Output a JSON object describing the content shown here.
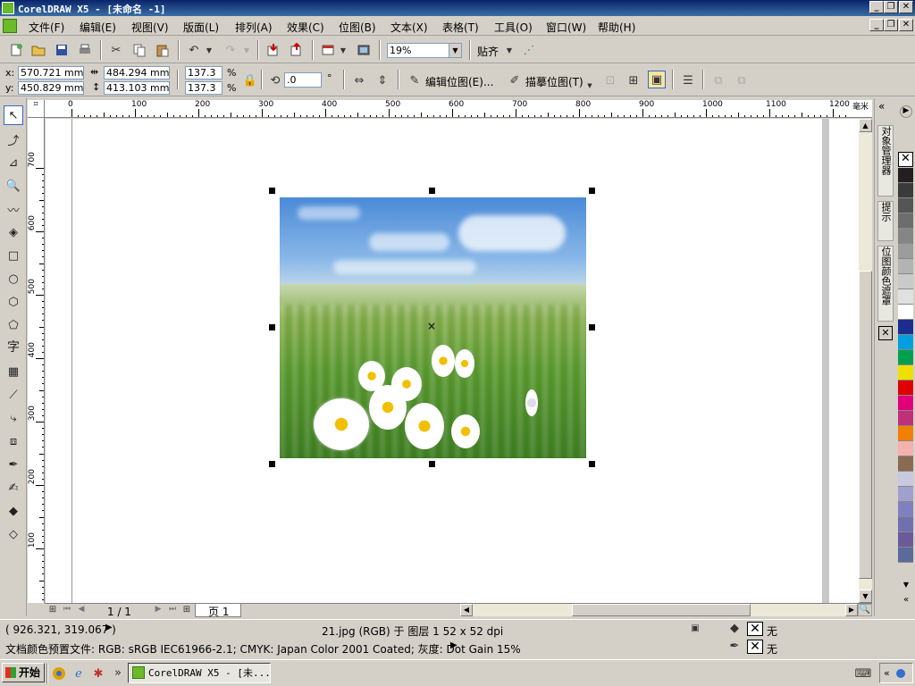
{
  "window": {
    "title": "CorelDRAW X5 - [未命名 -1]",
    "controls": {
      "minimize": "_",
      "restore": "❐",
      "close": "✕"
    }
  },
  "menu": {
    "items": [
      {
        "label": "文件(F)"
      },
      {
        "label": "编辑(E)"
      },
      {
        "label": "视图(V)"
      },
      {
        "label": "版面(L)"
      },
      {
        "label": "排列(A)"
      },
      {
        "label": "效果(C)"
      },
      {
        "label": "位图(B)"
      },
      {
        "label": "文本(X)"
      },
      {
        "label": "表格(T)"
      },
      {
        "label": "工具(O)"
      },
      {
        "label": "窗口(W)"
      },
      {
        "label": "帮助(H)"
      }
    ]
  },
  "standard_toolbar": {
    "zoom_value": "19%",
    "snap_label": "贴齐"
  },
  "property_bar": {
    "x_label": "x:",
    "x_value": "570.721 mm",
    "y_label": "y:",
    "y_value": "450.829 mm",
    "width_value": "484.294 mm",
    "height_value": "413.103 mm",
    "scale_x": "137.3",
    "scale_y": "137.3",
    "percent": "%",
    "rotation": ".0",
    "degree": "°",
    "edit_bitmap_label": "编辑位图(E)...",
    "trace_bitmap_label": "描摹位图(T)"
  },
  "ruler": {
    "unit": "毫米",
    "h_ticks": [
      "0",
      "100",
      "200",
      "300",
      "400",
      "500",
      "600",
      "700",
      "800",
      "900",
      "1000",
      "1100",
      "1200"
    ],
    "v_ticks": [
      "700",
      "600",
      "500",
      "400",
      "300",
      "200",
      "100"
    ]
  },
  "page_nav": {
    "page_count": "1 / 1",
    "page_tab": "页 1"
  },
  "docker": {
    "tabs": [
      "对象管理器",
      "提示",
      "位图颜色遮罩"
    ]
  },
  "palette": {
    "colors": [
      "#231f20",
      "#3a3a3a",
      "#555555",
      "#6d6d6d",
      "#858585",
      "#9c9c9c",
      "#b3b3b3",
      "#cacaca",
      "#e0e0e0",
      "#ffffff",
      "#1d2d8f",
      "#00a0e0",
      "#00a050",
      "#f0e000",
      "#e00000",
      "#e0007a",
      "#c0307a",
      "#f08000",
      "#f5b0b0",
      "#8a6a50",
      "#c8c8e0",
      "#a0a0d0",
      "#8080c0",
      "#7070b0",
      "#6a5a9a",
      "#5a6a9a"
    ]
  },
  "status": {
    "cursor_coords": "( 926.321, 319.067 )",
    "object_info": "21.jpg (RGB) 于 图层 1 52 x 52 dpi",
    "fill_none": "无",
    "outline_none": "无",
    "color_profile": "文档颜色预置文件: RGB: sRGB IEC61966-2.1; CMYK: Japan Color 2001 Coated; 灰度: Dot Gain 15%"
  },
  "taskbar": {
    "start_label": "开始",
    "task_label": "CorelDRAW X5 - [未..."
  }
}
